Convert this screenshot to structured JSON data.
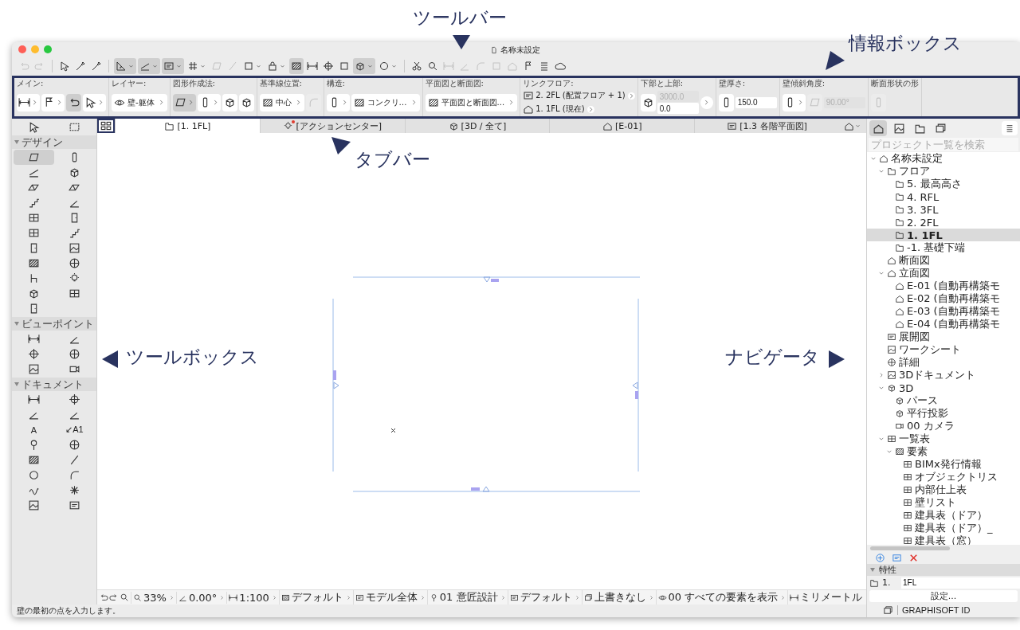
{
  "window": {
    "title": "名称未設定"
  },
  "callouts": [
    {
      "text": "ツールバー",
      "kind": "down"
    },
    {
      "text": "情報ボックス",
      "kind": "downleft"
    },
    {
      "text": "タブバー",
      "kind": "upleft"
    },
    {
      "text": "ツールボックス",
      "kind": "left"
    },
    {
      "text": "ナビゲータ",
      "kind": "right"
    }
  ],
  "toolbar": [
    [
      {
        "pressed": false,
        "menu": false,
        "disabled": true
      },
      {
        "pressed": false,
        "menu": false,
        "disabled": true
      }
    ],
    [
      {
        "pressed": false,
        "menu": false,
        "disabled": false
      },
      {
        "pressed": false,
        "menu": false,
        "disabled": false
      },
      {
        "pressed": false,
        "menu": false,
        "disabled": false
      }
    ],
    [
      {
        "pressed": true,
        "menu": true,
        "disabled": false
      },
      {
        "pressed": true,
        "menu": true,
        "disabled": false
      },
      {
        "pressed": true,
        "menu": true,
        "disabled": false
      },
      {
        "pressed": false,
        "menu": true,
        "disabled": false
      },
      {
        "pressed": false,
        "menu": false,
        "disabled": true
      },
      {
        "pressed": false,
        "menu": false,
        "disabled": true
      },
      {
        "pressed": false,
        "menu": true,
        "disabled": false
      },
      {
        "pressed": false,
        "menu": true,
        "disabled": false
      },
      {
        "pressed": true,
        "menu": false,
        "disabled": false
      },
      {
        "pressed": false,
        "menu": false,
        "disabled": false
      },
      {
        "pressed": false,
        "menu": false,
        "disabled": false
      },
      {
        "pressed": false,
        "menu": false,
        "disabled": false
      },
      {
        "pressed": true,
        "menu": true,
        "disabled": false
      },
      {
        "pressed": false,
        "menu": true,
        "disabled": false
      }
    ],
    [
      {
        "pressed": false,
        "menu": false,
        "disabled": false
      },
      {
        "pressed": false,
        "menu": false,
        "disabled": false
      },
      {
        "pressed": false,
        "menu": false,
        "disabled": true
      },
      {
        "pressed": false,
        "menu": false,
        "disabled": true
      },
      {
        "pressed": false,
        "menu": false,
        "disabled": true
      },
      {
        "pressed": false,
        "menu": false,
        "disabled": true
      },
      {
        "pressed": false,
        "menu": false,
        "disabled": true
      },
      {
        "pressed": false,
        "menu": false,
        "disabled": false
      },
      {
        "pressed": false,
        "menu": false,
        "disabled": false
      },
      {
        "pressed": false,
        "menu": false,
        "disabled": false
      }
    ]
  ],
  "info_box": [
    {
      "label": "メイン:",
      "controls": [
        {
          "kind": "icon",
          "menu": true,
          "pressed": false,
          "disabled": false
        },
        {
          "kind": "icon",
          "menu": true,
          "pressed": false,
          "disabled": false
        },
        {
          "kind": "icon",
          "menu": false,
          "pressed": true,
          "disabled": false
        },
        {
          "kind": "icon",
          "menu": true,
          "pressed": false,
          "disabled": false
        }
      ]
    },
    {
      "label": "レイヤー:",
      "controls": [
        {
          "kind": "field",
          "value": "壁-躯体"
        }
      ]
    },
    {
      "label": "図形作成法:",
      "controls": [
        {
          "kind": "icon",
          "menu": true,
          "pressed": true,
          "disabled": false
        },
        {
          "kind": "icon",
          "menu": true,
          "pressed": false,
          "disabled": false
        },
        {
          "kind": "icon",
          "menu": false,
          "pressed": false,
          "disabled": false
        },
        {
          "kind": "icon",
          "menu": false,
          "pressed": false,
          "disabled": false
        }
      ]
    },
    {
      "label": "基準線位置:",
      "controls": [
        {
          "kind": "field",
          "value": "中心"
        },
        {
          "kind": "icon",
          "menu": false,
          "pressed": false,
          "disabled": true
        }
      ]
    },
    {
      "label": "構造:",
      "controls": [
        {
          "kind": "icon",
          "menu": true,
          "pressed": false,
          "disabled": false
        },
        {
          "kind": "field",
          "value": "コンクリ…"
        }
      ]
    },
    {
      "label": "平面図と断面図:",
      "controls": [
        {
          "kind": "field",
          "value": "平面図と断面図..."
        }
      ]
    },
    {
      "label": "リンクフロア:",
      "controls": [
        {
          "kind": "links",
          "rows": [
            {
              "text": "2. 2FL (配置フロア + 1)"
            },
            {
              "text": "1. 1FL (現在)"
            }
          ]
        }
      ]
    },
    {
      "label": "下部と上部:",
      "controls": [
        {
          "kind": "icon",
          "menu": false,
          "pressed": false,
          "disabled": false
        },
        {
          "kind": "inputs",
          "items": [
            {
              "value": "3000.0",
              "disabled": true
            },
            {
              "value": "0.0",
              "disabled": false
            }
          ]
        },
        {
          "kind": "more"
        }
      ]
    },
    {
      "label": "壁厚さ:",
      "controls": [
        {
          "kind": "icon",
          "menu": false,
          "pressed": false,
          "disabled": false
        },
        {
          "kind": "inputs",
          "items": [
            {
              "value": "150.0",
              "disabled": false
            }
          ]
        }
      ]
    },
    {
      "label": "壁傾斜角度:",
      "controls": [
        {
          "kind": "icon",
          "menu": true,
          "pressed": false,
          "disabled": false
        },
        {
          "kind": "icon",
          "menu": false,
          "pressed": false,
          "disabled": true
        },
        {
          "kind": "inputs",
          "items": [
            {
              "value": "90.00°",
              "disabled": true
            }
          ]
        }
      ]
    },
    {
      "label": "断面形状の形",
      "controls": [
        {
          "kind": "icon",
          "menu": false,
          "pressed": false,
          "disabled": true
        }
      ]
    }
  ],
  "tabs": [
    {
      "label": "[1. 1FL]",
      "selected": true,
      "alert": false
    },
    {
      "label": "[アクションセンター]",
      "selected": false,
      "alert": true
    },
    {
      "label": "[3D / 全て]",
      "selected": false,
      "alert": false
    },
    {
      "label": "[E-01]",
      "selected": false,
      "alert": false
    },
    {
      "label": "[1.3 各階平面図]",
      "selected": false,
      "alert": false
    }
  ],
  "toolbox": {
    "top_tools": [
      {
        "selected": false
      },
      {
        "selected": false
      }
    ],
    "sections": [
      {
        "title": "デザイン",
        "expanded": true,
        "tools": [
          {
            "selected": true
          },
          {
            "selected": false
          },
          {
            "selected": false
          },
          {
            "selected": false
          },
          {
            "selected": false
          },
          {
            "selected": false
          },
          {
            "selected": false
          },
          {
            "selected": false
          },
          {
            "selected": false
          },
          {
            "selected": false
          },
          {
            "selected": false
          },
          {
            "selected": false
          },
          {
            "selected": false
          },
          {
            "selected": false
          },
          {
            "selected": false
          },
          {
            "selected": false
          },
          {
            "selected": false
          },
          {
            "selected": false
          },
          {
            "selected": false
          },
          {
            "selected": false
          },
          {
            "selected": false
          }
        ]
      },
      {
        "title": "ビューポイント",
        "expanded": true,
        "tools": [
          {
            "selected": false
          },
          {
            "selected": false
          },
          {
            "selected": false
          },
          {
            "selected": false
          },
          {
            "selected": false
          },
          {
            "selected": false
          }
        ]
      },
      {
        "title": "ドキュメント",
        "expanded": true,
        "tools": [
          {
            "selected": false
          },
          {
            "selected": false
          },
          {
            "selected": false
          },
          {
            "selected": false
          },
          {
            "selected": false,
            "glyph": "A"
          },
          {
            "selected": false,
            "glyph": "↙A1"
          },
          {
            "selected": false
          },
          {
            "selected": false
          },
          {
            "selected": false
          },
          {
            "selected": false
          },
          {
            "selected": false
          },
          {
            "selected": false
          },
          {
            "selected": false
          },
          {
            "selected": false
          },
          {
            "selected": false
          },
          {
            "selected": false
          }
        ]
      }
    ]
  },
  "view_bar": [
    {
      "value": "33%"
    },
    {
      "value": "0.00°"
    },
    {
      "value": "1:100"
    },
    {
      "value": "デフォルト"
    },
    {
      "value": "モデル全体"
    },
    {
      "value": "01 意匠設計"
    },
    {
      "value": "デフォルト"
    },
    {
      "value": "上書きなし"
    },
    {
      "value": "00 すべての要素を表示"
    },
    {
      "value": "ミリメートル"
    }
  ],
  "status_bar": {
    "text": "壁の最初の点を入力します。"
  },
  "navigator": {
    "tabs": [
      {
        "selected": true
      },
      {
        "selected": false
      },
      {
        "selected": false
      },
      {
        "selected": false
      }
    ],
    "search": {
      "placeholder": "プロジェクト一覧を検索"
    },
    "tree": [
      {
        "label": "名称未設定",
        "kind": "project",
        "expanded": true,
        "selected": false,
        "children": [
          {
            "label": "フロア",
            "kind": "folder",
            "expanded": true,
            "selected": false,
            "children": [
              {
                "label": "5. 最高高さ",
                "kind": "story",
                "selected": false
              },
              {
                "label": "4. RFL",
                "kind": "story",
                "selected": false
              },
              {
                "label": "3. 3FL",
                "kind": "story",
                "selected": false
              },
              {
                "label": "2. 2FL",
                "kind": "story",
                "selected": false
              },
              {
                "label": "1. 1FL",
                "kind": "story",
                "selected": true
              },
              {
                "label": "-1. 基礎下端",
                "kind": "story",
                "selected": false
              }
            ]
          },
          {
            "label": "断面図",
            "kind": "section",
            "selected": false
          },
          {
            "label": "立面図",
            "kind": "elevation",
            "expanded": true,
            "selected": false,
            "children": [
              {
                "label": "E-01 (自動再構築モ",
                "kind": "elevation",
                "selected": false
              },
              {
                "label": "E-02 (自動再構築モ",
                "kind": "elevation",
                "selected": false
              },
              {
                "label": "E-03 (自動再構築モ",
                "kind": "elevation",
                "selected": false
              },
              {
                "label": "E-04 (自動再構築モ",
                "kind": "elevation",
                "selected": false
              }
            ]
          },
          {
            "label": "展開図",
            "kind": "interior",
            "selected": false
          },
          {
            "label": "ワークシート",
            "kind": "worksheet",
            "selected": false
          },
          {
            "label": "詳細",
            "kind": "detail",
            "selected": false
          },
          {
            "label": "3Dドキュメント",
            "kind": "document3d",
            "expanded": false,
            "selected": false
          },
          {
            "label": "3D",
            "kind": "model3d",
            "expanded": true,
            "selected": false,
            "children": [
              {
                "label": "パース",
                "kind": "perspective",
                "selected": false
              },
              {
                "label": "平行投影",
                "kind": "axon",
                "selected": false
              },
              {
                "label": "00 カメラ",
                "kind": "camera",
                "selected": false
              }
            ]
          },
          {
            "label": "一覧表",
            "kind": "schedule",
            "expanded": true,
            "selected": false,
            "children": [
              {
                "label": "要素",
                "kind": "schedule_group",
                "expanded": true,
                "selected": false,
                "children": [
                  {
                    "label": "BIMx発行情報",
                    "kind": "schedule",
                    "selected": false
                  },
                  {
                    "label": "オブジェクトリス",
                    "kind": "schedule",
                    "selected": false
                  },
                  {
                    "label": "内部仕上表",
                    "kind": "schedule",
                    "selected": false
                  },
                  {
                    "label": "壁リスト",
                    "kind": "schedule",
                    "selected": false
                  },
                  {
                    "label": "建具表（ドア）",
                    "kind": "schedule",
                    "selected": false
                  },
                  {
                    "label": "建具表（ドア）_",
                    "kind": "schedule",
                    "selected": false
                  },
                  {
                    "label": "建具表（窓）",
                    "kind": "schedule",
                    "selected": false
                  }
                ]
              }
            ]
          }
        ]
      }
    ],
    "properties": {
      "title": "特性",
      "expanded": true,
      "id": "1.",
      "name": "1FL",
      "button": "設定..."
    },
    "footer": "GRAPHISOFT ID"
  }
}
